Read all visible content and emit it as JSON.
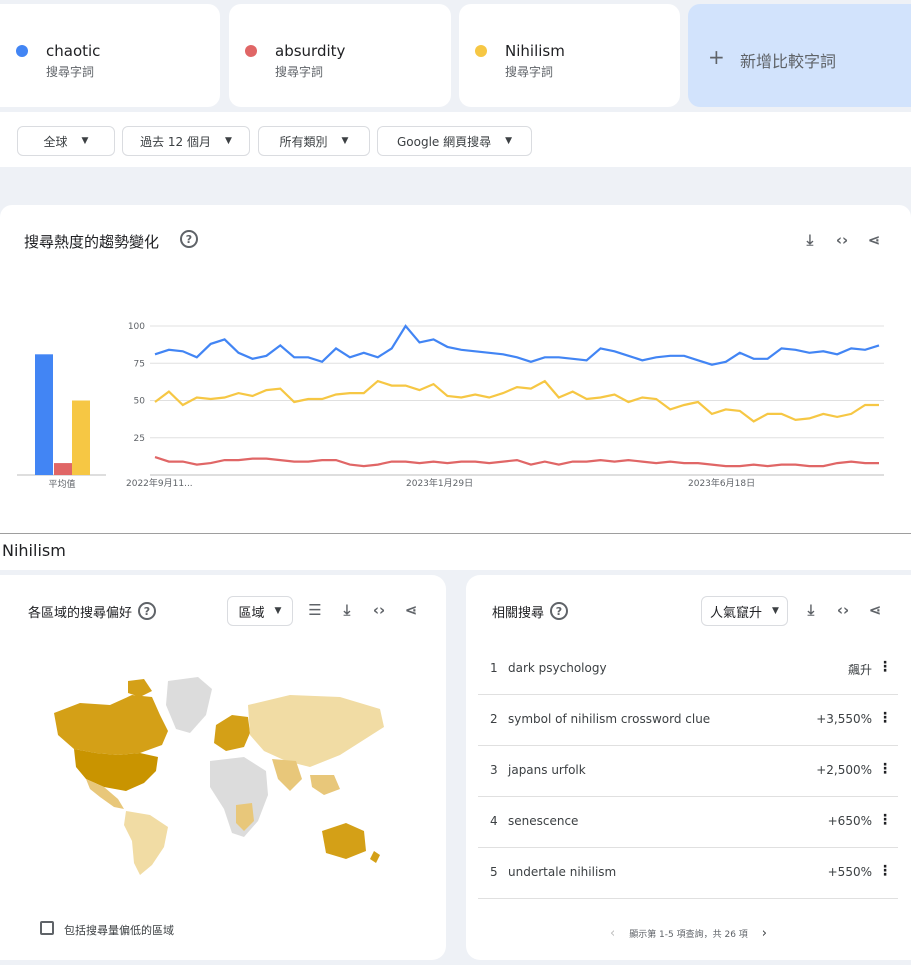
{
  "terms": [
    {
      "name": "chaotic",
      "sub": "搜尋字詞",
      "color": "#4285f4"
    },
    {
      "name": "absurdity",
      "sub": "搜尋字詞",
      "color": "#e06666"
    },
    {
      "name": "Nihilism",
      "sub": "搜尋字詞",
      "color": "#f6c744"
    }
  ],
  "add_compare": {
    "plus": "+",
    "label": "新增比較字詞"
  },
  "filters": {
    "region": "全球",
    "time": "過去 12 個月",
    "category": "所有類別",
    "search_type": "Google 網頁搜尋"
  },
  "trend": {
    "title": "搜尋熱度的趨勢變化",
    "help": "?",
    "avg_label": "平均值"
  },
  "chart_data": {
    "type": "line",
    "title": "搜尋熱度的趨勢變化",
    "x_tick_labels": [
      "2022年9月11...",
      "2023年1月29日",
      "2023年6月18日"
    ],
    "y_ticks": [
      25,
      50,
      75,
      100
    ],
    "ylim": [
      0,
      100
    ],
    "grid": true,
    "series": [
      {
        "name": "chaotic",
        "color": "#4285f4",
        "values": [
          81,
          84,
          83,
          79,
          88,
          91,
          82,
          78,
          80,
          87,
          79,
          79,
          76,
          85,
          79,
          82,
          79,
          85,
          100,
          89,
          91,
          86,
          84,
          83,
          82,
          81,
          79,
          76,
          79,
          79,
          78,
          77,
          85,
          83,
          80,
          77,
          79,
          80,
          80,
          77,
          74,
          76,
          82,
          78,
          78,
          85,
          84,
          82,
          83,
          81,
          85,
          84,
          87
        ]
      },
      {
        "name": "absurdity",
        "color": "#e06666",
        "values": [
          12,
          9,
          9,
          7,
          8,
          10,
          10,
          11,
          11,
          10,
          9,
          9,
          10,
          10,
          7,
          6,
          7,
          9,
          9,
          8,
          9,
          8,
          9,
          9,
          8,
          9,
          10,
          7,
          9,
          7,
          9,
          9,
          10,
          9,
          10,
          9,
          8,
          9,
          8,
          8,
          7,
          6,
          6,
          7,
          6,
          7,
          7,
          6,
          6,
          8,
          9,
          8,
          8
        ]
      },
      {
        "name": "Nihilism",
        "color": "#f6c744",
        "values": [
          49,
          56,
          47,
          52,
          51,
          52,
          55,
          53,
          57,
          58,
          49,
          51,
          51,
          54,
          55,
          55,
          63,
          60,
          60,
          57,
          61,
          53,
          52,
          54,
          52,
          55,
          59,
          58,
          63,
          52,
          56,
          51,
          52,
          54,
          49,
          52,
          51,
          44,
          47,
          49,
          41,
          44,
          43,
          36,
          41,
          41,
          37,
          38,
          41,
          39,
          41,
          47,
          47
        ]
      },
      {
        "name": "average",
        "values": {
          "chaotic": 81,
          "absurdity": 8,
          "Nihilism": 50
        }
      }
    ]
  },
  "section_heading": "Nihilism",
  "region_panel": {
    "title": "各區域的搜尋偏好",
    "help": "?",
    "dropdown": "區域",
    "checkbox_label": "包括搜尋量偏低的區域"
  },
  "related_panel": {
    "title": "相關搜尋",
    "help": "?",
    "dropdown": "人氣竄升",
    "rows": [
      {
        "idx": "1",
        "text": "dark psychology",
        "value": "飆升"
      },
      {
        "idx": "2",
        "text": "symbol of nihilism crossword clue",
        "value": "+3,550%"
      },
      {
        "idx": "3",
        "text": "japans urfolk",
        "value": "+2,500%"
      },
      {
        "idx": "4",
        "text": "senescence",
        "value": "+650%"
      },
      {
        "idx": "5",
        "text": "undertale nihilism",
        "value": "+550%"
      }
    ],
    "pagination": "顯示第 1-5 項查詢，共 26 項"
  }
}
